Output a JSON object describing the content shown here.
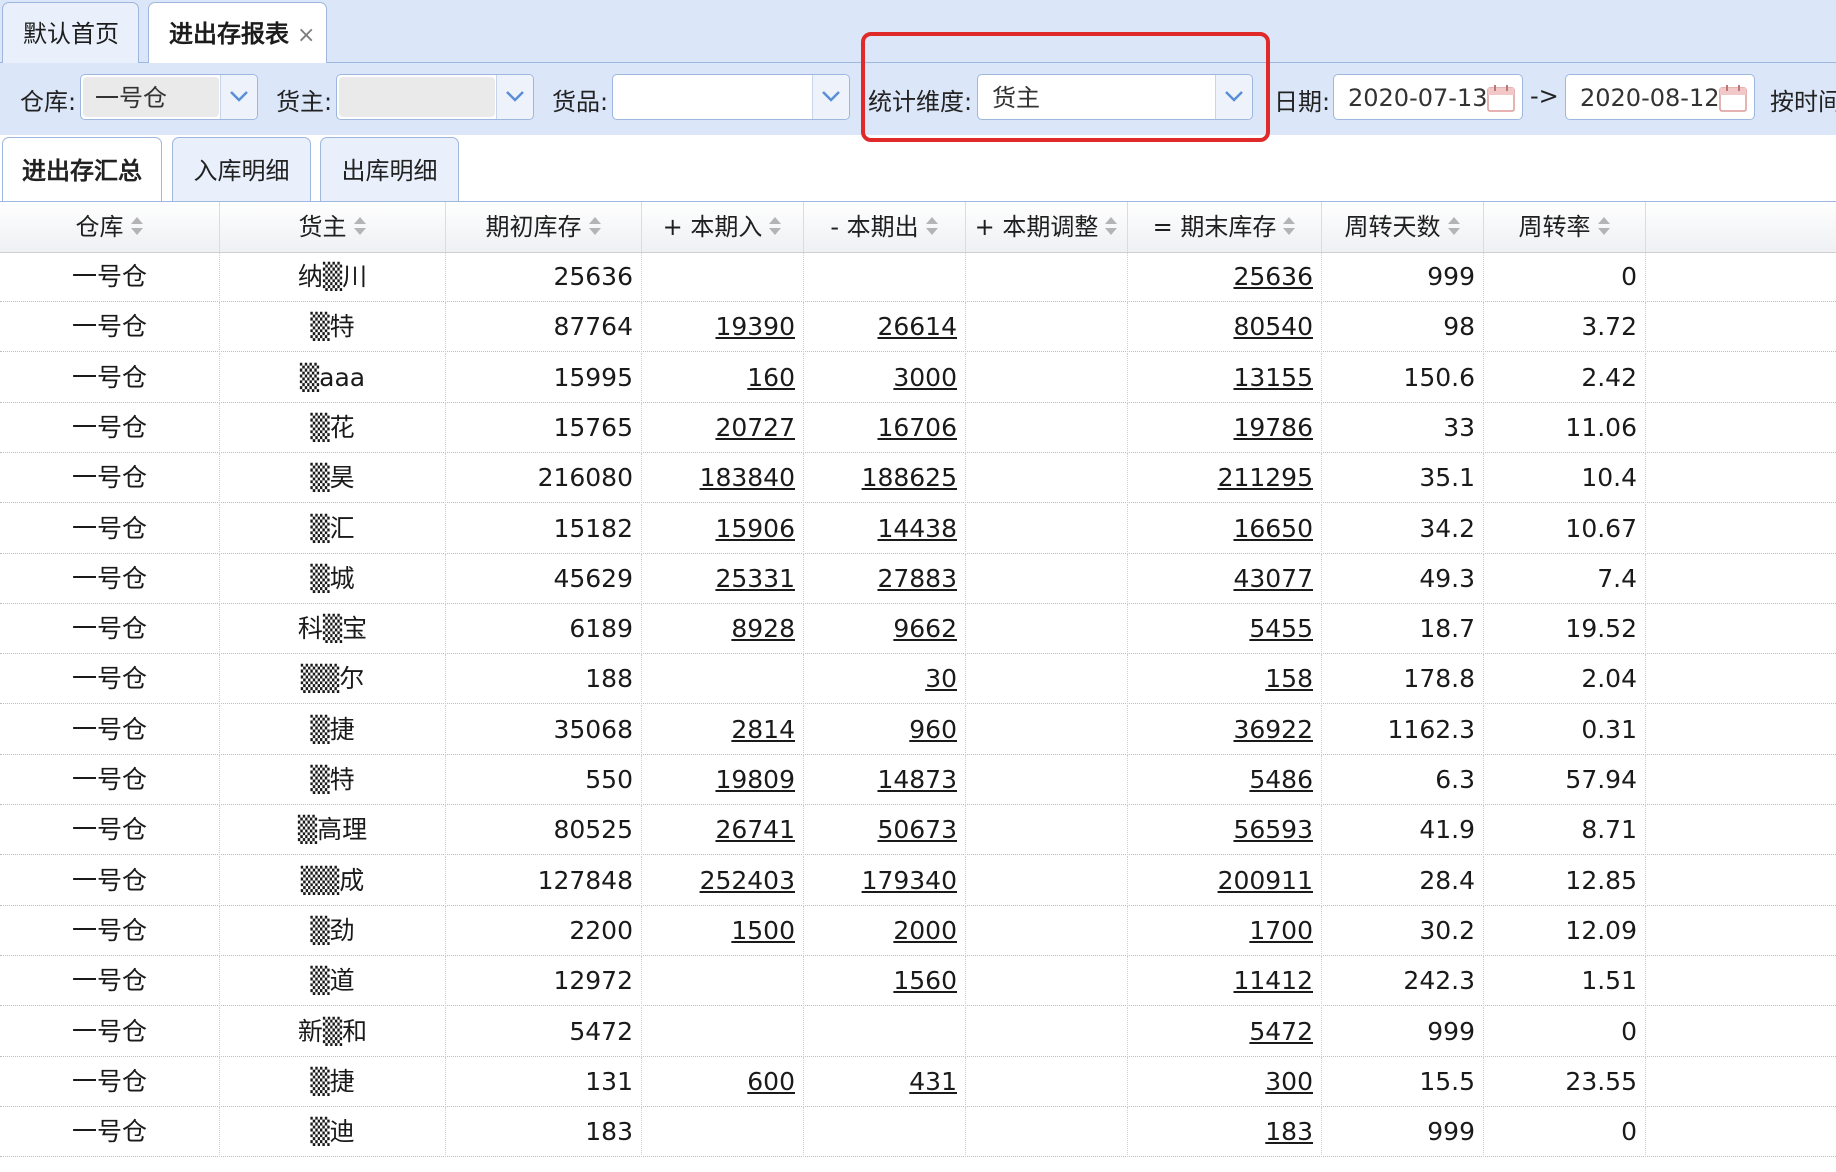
{
  "top_tabs": [
    {
      "label": "默认首页",
      "active": false
    },
    {
      "label": "进出存报表",
      "active": true,
      "close": "×"
    }
  ],
  "filters": {
    "warehouse_label": "仓库:",
    "warehouse_value": "一号仓",
    "owner_label": "货主:",
    "owner_value": "",
    "goods_label": "货品:",
    "goods_value": "",
    "dimension_label": "统计维度:",
    "dimension_value": "货主",
    "date_label": "日期:",
    "date_start": "2020-07-13",
    "date_sep": "->",
    "date_end": "2020-08-12",
    "by_time_label": "按时间"
  },
  "sub_tabs": [
    {
      "label": "进出存汇总",
      "active": true
    },
    {
      "label": "入库明细",
      "active": false
    },
    {
      "label": "出库明细",
      "active": false
    }
  ],
  "table": {
    "columns": [
      "仓库",
      "货主",
      "期初库存",
      "+ 本期入",
      "- 本期出",
      "+ 本期调整",
      "= 期末库存",
      "周转天数",
      "周转率"
    ],
    "rows": [
      {
        "warehouse": "一号仓",
        "owner": "纳▒川",
        "opening": "25636",
        "in": "",
        "out": "",
        "adjust": "",
        "closing": "25636",
        "days": "999",
        "rate": "0"
      },
      {
        "warehouse": "一号仓",
        "owner": "▒特",
        "opening": "87764",
        "in": "19390",
        "out": "26614",
        "adjust": "",
        "closing": "80540",
        "days": "98",
        "rate": "3.72"
      },
      {
        "warehouse": "一号仓",
        "owner": "▒aaa",
        "opening": "15995",
        "in": "160",
        "out": "3000",
        "adjust": "",
        "closing": "13155",
        "days": "150.6",
        "rate": "2.42"
      },
      {
        "warehouse": "一号仓",
        "owner": "▒花",
        "opening": "15765",
        "in": "20727",
        "out": "16706",
        "adjust": "",
        "closing": "19786",
        "days": "33",
        "rate": "11.06"
      },
      {
        "warehouse": "一号仓",
        "owner": "▒昊",
        "opening": "216080",
        "in": "183840",
        "out": "188625",
        "adjust": "",
        "closing": "211295",
        "days": "35.1",
        "rate": "10.4"
      },
      {
        "warehouse": "一号仓",
        "owner": "▒汇",
        "opening": "15182",
        "in": "15906",
        "out": "14438",
        "adjust": "",
        "closing": "16650",
        "days": "34.2",
        "rate": "10.67"
      },
      {
        "warehouse": "一号仓",
        "owner": "▒城",
        "opening": "45629",
        "in": "25331",
        "out": "27883",
        "adjust": "",
        "closing": "43077",
        "days": "49.3",
        "rate": "7.4"
      },
      {
        "warehouse": "一号仓",
        "owner": "科▒宝",
        "opening": "6189",
        "in": "8928",
        "out": "9662",
        "adjust": "",
        "closing": "5455",
        "days": "18.7",
        "rate": "19.52"
      },
      {
        "warehouse": "一号仓",
        "owner": "▒▒尔",
        "opening": "188",
        "in": "",
        "out": "30",
        "adjust": "",
        "closing": "158",
        "days": "178.8",
        "rate": "2.04"
      },
      {
        "warehouse": "一号仓",
        "owner": "▒捷",
        "opening": "35068",
        "in": "2814",
        "out": "960",
        "adjust": "",
        "closing": "36922",
        "days": "1162.3",
        "rate": "0.31"
      },
      {
        "warehouse": "一号仓",
        "owner": "▒特",
        "opening": "550",
        "in": "19809",
        "out": "14873",
        "adjust": "",
        "closing": "5486",
        "days": "6.3",
        "rate": "57.94"
      },
      {
        "warehouse": "一号仓",
        "owner": "▒高理",
        "opening": "80525",
        "in": "26741",
        "out": "50673",
        "adjust": "",
        "closing": "56593",
        "days": "41.9",
        "rate": "8.71"
      },
      {
        "warehouse": "一号仓",
        "owner": "▒▒成",
        "opening": "127848",
        "in": "252403",
        "out": "179340",
        "adjust": "",
        "closing": "200911",
        "days": "28.4",
        "rate": "12.85"
      },
      {
        "warehouse": "一号仓",
        "owner": "▒劲",
        "opening": "2200",
        "in": "1500",
        "out": "2000",
        "adjust": "",
        "closing": "1700",
        "days": "30.2",
        "rate": "12.09"
      },
      {
        "warehouse": "一号仓",
        "owner": "▒道",
        "opening": "12972",
        "in": "",
        "out": "1560",
        "adjust": "",
        "closing": "11412",
        "days": "242.3",
        "rate": "1.51"
      },
      {
        "warehouse": "一号仓",
        "owner": "新▒和",
        "opening": "5472",
        "in": "",
        "out": "",
        "adjust": "",
        "closing": "5472",
        "days": "999",
        "rate": "0"
      },
      {
        "warehouse": "一号仓",
        "owner": "▒捷",
        "opening": "131",
        "in": "600",
        "out": "431",
        "adjust": "",
        "closing": "300",
        "days": "15.5",
        "rate": "23.55"
      },
      {
        "warehouse": "一号仓",
        "owner": "▒迪",
        "opening": "183",
        "in": "",
        "out": "",
        "adjust": "",
        "closing": "183",
        "days": "999",
        "rate": "0"
      }
    ]
  },
  "colors": {
    "header_bg": "#dbe6f8",
    "border": "#9db7de",
    "highlight_box": "#e02a2a"
  }
}
